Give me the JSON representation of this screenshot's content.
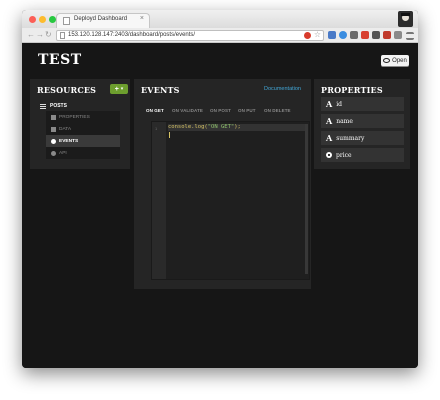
{
  "browser": {
    "tab_title": "Deployd Dashboard",
    "tab_close": "×",
    "url": "153.120.128.147:2403/dashboard/posts/events/",
    "nav_back": "←",
    "nav_forward": "→",
    "nav_reload": "↻",
    "star": "☆"
  },
  "app": {
    "title": "TEST",
    "open_button": "Open"
  },
  "resources": {
    "title": "RESOURCES",
    "add_label": "+",
    "add_caret": "▾",
    "root": "POSTS",
    "items": [
      {
        "label": "PROPERTIES",
        "icon": "grid-icon"
      },
      {
        "label": "DATA",
        "icon": "grid-icon"
      },
      {
        "label": "EVENTS",
        "icon": "info-icon"
      },
      {
        "label": "API",
        "icon": "info-icon"
      }
    ]
  },
  "events": {
    "title": "EVENTS",
    "doc_link": "Documentation",
    "tabs": [
      "ON GET",
      "ON VALIDATE",
      "ON POST",
      "ON PUT",
      "ON DELETE"
    ],
    "active_tab": "ON GET",
    "code": {
      "line_number": "1",
      "call": "console.log(",
      "string": "\"ON GET\"",
      "end": ");"
    }
  },
  "properties": {
    "title": "PROPERTIES",
    "items": [
      {
        "name": "id",
        "icon": "A"
      },
      {
        "name": "name",
        "icon": "A"
      },
      {
        "name": "summary",
        "icon": "A"
      },
      {
        "name": "price",
        "icon": "number-icon"
      }
    ]
  },
  "colors": {
    "accent_green": "#6d9e2e",
    "link_blue": "#42a6d6",
    "background": "#161616",
    "panel": "#252525"
  }
}
